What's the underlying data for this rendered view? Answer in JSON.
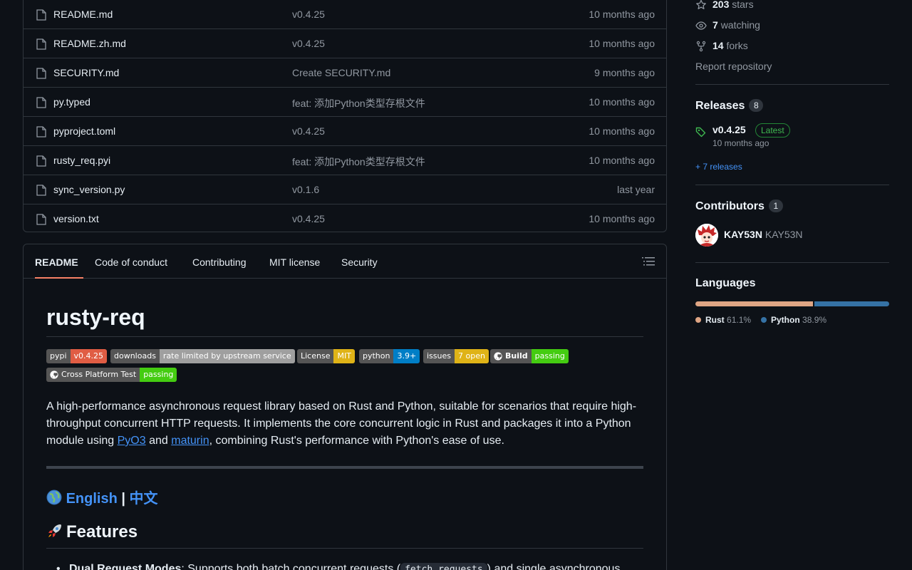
{
  "files": [
    {
      "name": "README.md",
      "commit": "v0.4.25",
      "time": "10 months ago"
    },
    {
      "name": "README.zh.md",
      "commit": "v0.4.25",
      "time": "10 months ago"
    },
    {
      "name": "SECURITY.md",
      "commit": "Create SECURITY.md",
      "time": "9 months ago"
    },
    {
      "name": "py.typed",
      "commit": "feat: 添加Python类型存根文件",
      "time": "10 months ago"
    },
    {
      "name": "pyproject.toml",
      "commit": "v0.4.25",
      "time": "10 months ago"
    },
    {
      "name": "rusty_req.pyi",
      "commit": "feat: 添加Python类型存根文件",
      "time": "10 months ago"
    },
    {
      "name": "sync_version.py",
      "commit": "v0.1.6",
      "time": "last year"
    },
    {
      "name": "version.txt",
      "commit": "v0.4.25",
      "time": "10 months ago"
    }
  ],
  "readme_tabs": [
    "README",
    "Code of conduct",
    "Contributing",
    "MIT license",
    "Security"
  ],
  "readme": {
    "title": "rusty-req",
    "badges": [
      {
        "label": "pypi",
        "value": "v0.4.25",
        "color": "#e05d44"
      },
      {
        "label": "downloads",
        "value": "rate limited by upstream service",
        "color": "#9f9f9f"
      },
      {
        "label": "License",
        "value": "MIT",
        "color": "#dfb317"
      },
      {
        "label": "python",
        "value": "3.9+",
        "color": "#007ec6"
      },
      {
        "label": "issues",
        "value": "7 open",
        "color": "#dfb317"
      },
      {
        "label": "Build",
        "value": "passing",
        "color": "#4c1"
      },
      {
        "label": "Cross Platform Test",
        "value": "passing",
        "color": "#4c1"
      }
    ],
    "intro_before": "A high-performance asynchronous request library based on Rust and Python, suitable for scenarios that require high-throughput concurrent HTTP requests. It implements the core concurrent logic in Rust and packages it into a Python module using ",
    "link_pyo3": "PyO3",
    "intro_and": " and ",
    "link_maturin": "maturin",
    "intro_after": ", combining Rust's performance with Python's ease of use.",
    "lang_english": "English",
    "lang_sep": " | ",
    "lang_chinese": "中文",
    "features_heading": "Features",
    "bullet_bold": "Dual Request Modes",
    "bullet_text": ": Supports both batch concurrent requests (",
    "bullet_code": "fetch_requests",
    "bullet_after": ") and single asynchronous"
  },
  "sidebar": {
    "stars": "203",
    "stars_label": "stars",
    "watching": "7",
    "watching_label": "watching",
    "forks": "14",
    "forks_label": "forks",
    "report": "Report repository",
    "releases_heading": "Releases",
    "releases_count": "8",
    "latest_version": "v0.4.25",
    "latest_badge": "Latest",
    "latest_time": "10 months ago",
    "more_releases": "+ 7 releases",
    "contributors_heading": "Contributors",
    "contributors_count": "1",
    "contributor_login": "KAY53N",
    "contributor_name": "KAY53N",
    "languages_heading": "Languages",
    "languages": [
      {
        "name": "Rust",
        "percent": "61.1%",
        "value": 61.1,
        "color": "#dea584"
      },
      {
        "name": "Python",
        "percent": "38.9%",
        "value": 38.9,
        "color": "#3572a5"
      }
    ]
  }
}
